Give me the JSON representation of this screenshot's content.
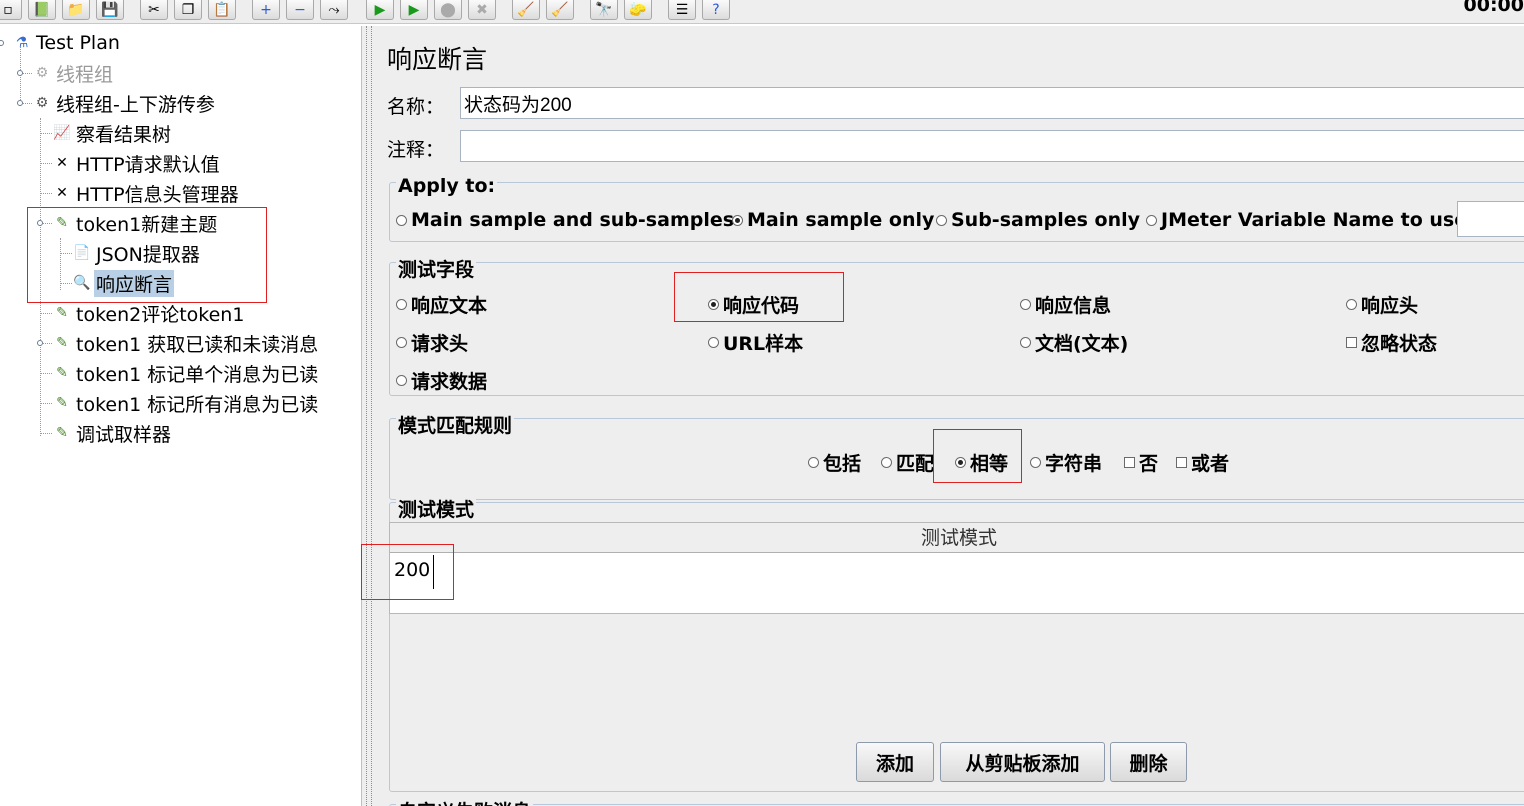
{
  "toolbar": {
    "timer": "00:00",
    "buttons": [
      "new-icon",
      "templates-icon",
      "open-icon",
      "save-icon",
      "cut-icon",
      "copy-icon",
      "paste-icon",
      "expand-icon",
      "collapse-icon",
      "toggle-icon",
      "start-icon",
      "start-no-pause-icon",
      "stop-icon",
      "shutdown-icon",
      "clear-icon",
      "clear-all-icon",
      "search-icon",
      "reset-search-icon",
      "function-helper-icon",
      "help-icon"
    ]
  },
  "tree": {
    "items": [
      {
        "label": "Test Plan"
      },
      {
        "label": "线程组"
      },
      {
        "label": "线程组-上下游传参"
      },
      {
        "label": "察看结果树"
      },
      {
        "label": "HTTP请求默认值"
      },
      {
        "label": "HTTP信息头管理器"
      },
      {
        "label": "token1新建主题"
      },
      {
        "label": "JSON提取器"
      },
      {
        "label": "响应断言"
      },
      {
        "label": "token2评论token1"
      },
      {
        "label": "token1 获取已读和未读消息"
      },
      {
        "label": "token1 标记单个消息为已读"
      },
      {
        "label": "token1 标记所有消息为已读"
      },
      {
        "label": "调试取样器"
      }
    ]
  },
  "panel": {
    "title": "响应断言",
    "name_label": "名称：",
    "name_value": "状态码为200",
    "comment_label": "注释：",
    "comment_value": "",
    "apply_to": {
      "legend": "Apply to:",
      "options": [
        "Main sample and sub-samples",
        "Main sample only",
        "Sub-samples only",
        "JMeter Variable Name to use"
      ],
      "selected": "Main sample only",
      "variable_value": ""
    },
    "test_field": {
      "legend": "测试字段",
      "options": [
        "响应文本",
        "响应代码",
        "响应信息",
        "响应头",
        "请求头",
        "URL样本",
        "文档(文本)",
        "忽略状态",
        "请求数据"
      ],
      "selected": "响应代码",
      "ignore_status_checked": false
    },
    "match_rules": {
      "legend": "模式匹配规则",
      "options": [
        "包括",
        "匹配",
        "相等",
        "字符串",
        "否",
        "或者"
      ],
      "selected": "相等",
      "not_checked": false,
      "or_checked": false
    },
    "patterns": {
      "legend": "测试模式",
      "column_header": "测试模式",
      "rows": [
        "200"
      ]
    },
    "buttons": {
      "add": "添加",
      "add_from_clipboard": "从剪贴板添加",
      "delete": "删除"
    },
    "custom_failure_legend": "自定义失败消息"
  }
}
